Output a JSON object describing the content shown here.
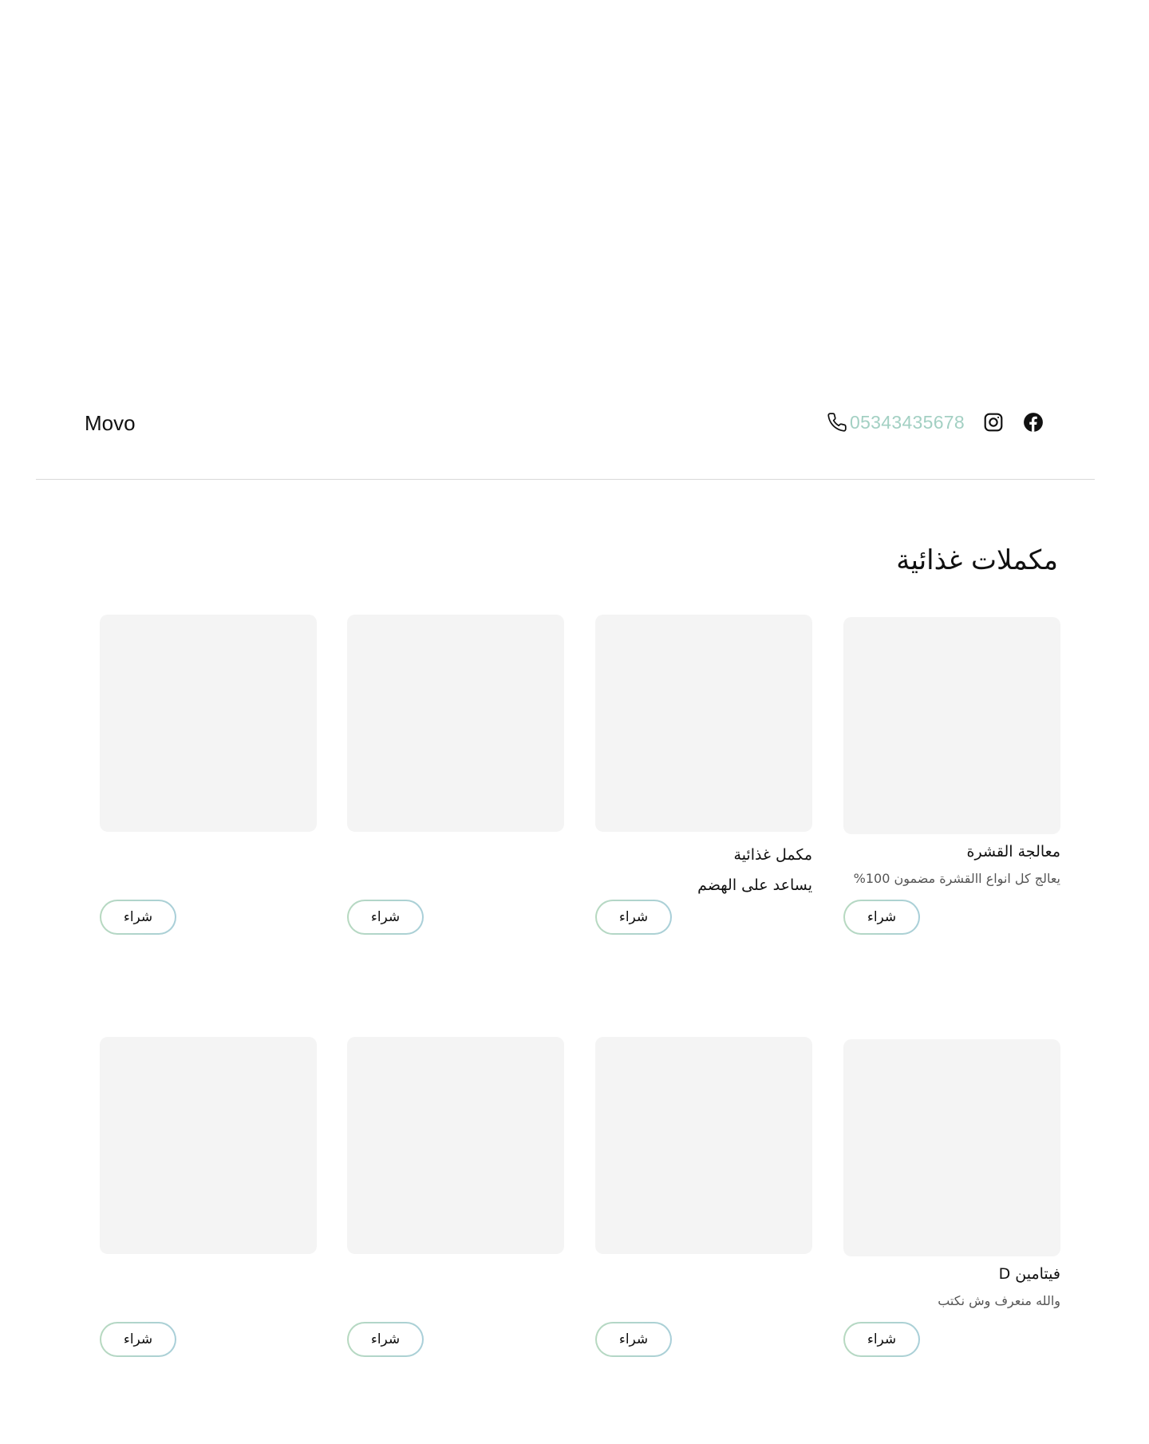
{
  "header": {
    "brand": "Movo",
    "phone": "05343435678",
    "icons": [
      "phone-icon",
      "instagram-icon",
      "facebook-icon"
    ]
  },
  "section": {
    "title": "مكملات غذائية"
  },
  "products": [
    {
      "title": "معالجة القشرة",
      "description": "يعالج كل انواع االقشرة مضمون 100%",
      "buy_label": "شراء"
    },
    {
      "title": "مكمل غذائية",
      "description": "يساعد على الهضم",
      "buy_label": "شراء"
    },
    {
      "title": "",
      "description": "",
      "buy_label": "شراء"
    },
    {
      "title": "",
      "description": "",
      "buy_label": "شراء"
    },
    {
      "title": "فيتامين D",
      "description": "والله منعرف وش نكتب",
      "buy_label": "شراء"
    },
    {
      "title": "",
      "description": "",
      "buy_label": "شراء"
    },
    {
      "title": "",
      "description": "",
      "buy_label": "شراء"
    },
    {
      "title": "",
      "description": "",
      "buy_label": "شراء"
    }
  ],
  "colors": {
    "phone_text": "#a3d0c3",
    "card_placeholder": "#f4f4f4",
    "button_border_start": "#b7d9c0",
    "button_border_end": "#a9cfd9",
    "divider": "#d9d9d9"
  }
}
